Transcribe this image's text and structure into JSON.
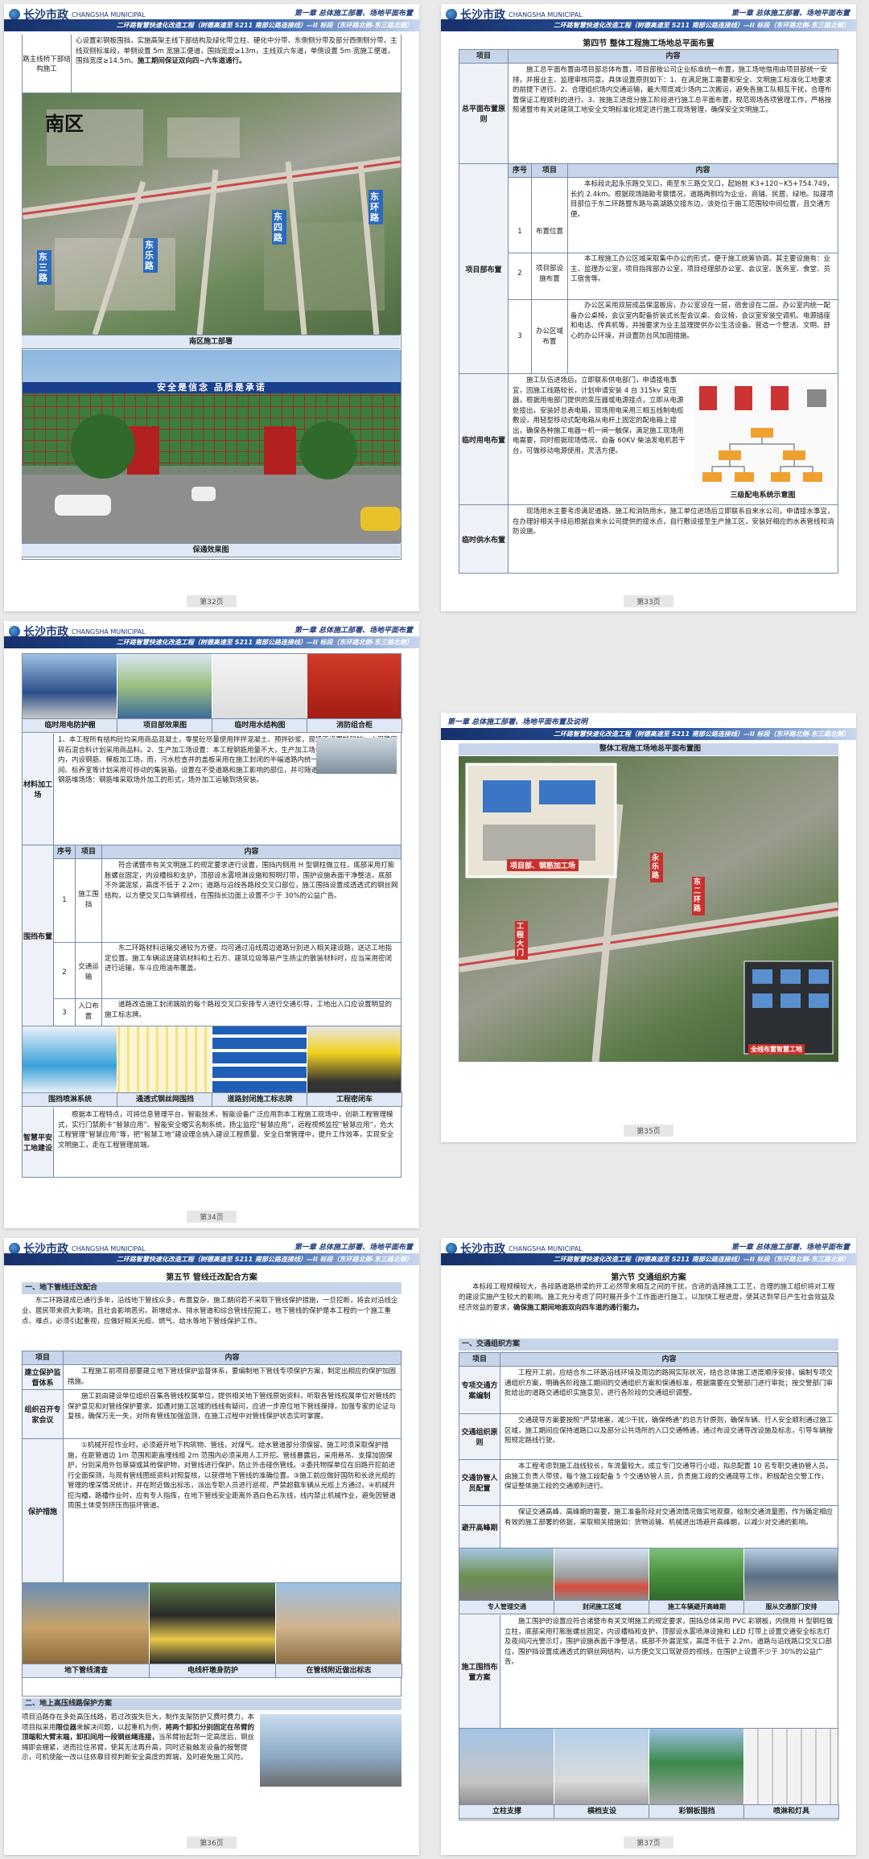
{
  "header": {
    "logo_cn": "长沙市政",
    "logo_en": "CHANGSHA MUNICIPAL",
    "chapter": "第一章 总体施工部署、场地平面布置",
    "chapter_alt": "第一章 总体施工部署、场地平面布置及说明",
    "project": "二环路智慧快速化改造工程（树德高速至 S211 南部公路连接线）—II 标段（东环路北侧-东三路北侧）"
  },
  "p32": {
    "text": "心设置彩钢板围挡，实施高架主线下部结构及绿化带立柱、硬化中分带、东侧侧分带及部分西侧侧分带，主线双侧标准段，单侧设置 5m 宽施工便道，围挡宽度≥13m，主线双六车道，单侧设置 5m 宽施工便道，围挡宽度≥14.5m。",
    "bold_text": "施工期间保证双向四~六车道通行。",
    "left_label": "路主线桥下部结构施工",
    "map_title": "南区",
    "map_labels": [
      "东三路",
      "东乐路",
      "东四路",
      "东环路"
    ],
    "cap1": "南区施工部署",
    "gate_banner": "安全是信念  品质是承诺",
    "cap2": "保通效果图",
    "page": "第32页"
  },
  "p33": {
    "section": "第四节  整体工程施工场地总平面布置",
    "th_item": "项目",
    "th_content": "内容",
    "r1_label": "总平面布置原则",
    "r1_text": "施工总平面布置由项目部总体布置，项目部按公司企业标准统一布置，施工场地借用由项目部统一安排，并报业主、监理审核同意。具体设置原则如下：1、在满足施工需要和安全、文明施工标准化工地要求的前提下进行。2、合理组织场内交通运输，最大限度减少场内二次搬运，避免各施工队相互干扰，合理布置保证工程顺利的进行。3、按施工进度分施工阶段进行施工总平面布置，规范现场各项管理工作，严格按照诸暨市有关对建筑工地安全文明标准化规定进行施工现场管理，确保安全文明施工。",
    "r2_label": "项目部布置",
    "sub_th": [
      "序号",
      "项目",
      "内容"
    ],
    "sub_rows": [
      {
        "no": "1",
        "item": "布置位置",
        "text": "本标段北起永乐路交叉口，南至东三路交叉口，起始桩 K3+120~K5+754.749，长约 2.4km。根据现场踏勘考察情况，道路两侧均为企业、商铺、民居、绿地。拟建项目部位于东二环路暨东路与高湖路交接东边，该处位于施工范围较中间位置，且交通方便。"
      },
      {
        "no": "2",
        "item": "项目部设施布置",
        "text": "本工程施工办公区域采取集中办公的形式，便于施工统筹协调。其主要设施有：业主、监理办公室，项目指挥部办公室，项目经理部办公室、会议室、医务室、食堂、员工宿舍等。"
      },
      {
        "no": "3",
        "item": "办公区域布置",
        "text": "办公区采用双层成品保温板房，办公室设在一层，宿舍设在二层。办公室内统一配备办公桌椅，会议室内配备折装式长型会议桌、会议椅，会议室安装空调机、电源插座和电话、传真机等，并按要求为业主监理提供办公生活设备。营造一个整洁、文明、舒心的办公环境，并设置防台风加固措施。"
      }
    ],
    "r3_label": "临时用电布置",
    "r3_text": "施工队伍进场后，立即联系供电部门，申请接电事宜，因施工线路较长，计划申请安装 4 台 315kv 变压器，根据用电部门提供的变压器或电源接点，立即从电源处接出，安装好总表电箱，现场用电采用三相五线制电缆敷设，用轻型移动式配电箱从电杆上固定的配电箱上接出，确保各种施工电器一机一闸一触保，满足施工现场用电需要，同时根据现场情况，自备 60KV 柴油发电机若干台，可做移动电源使用，灵活方便。",
    "r3_caption": "三级配电系统示意图",
    "r4_label": "临时供水布置",
    "r4_text": "现场用水主要考虑满足道路、施工和消防用水，施工单位进场后立即联系自来水公司，申请接水事宜，在办理好相关手续后根据自来水公司提供的接水点，自行敷设接至生产施工区，安装好相应的水表管线和消防设施。",
    "page": "第33页"
  },
  "p34": {
    "caps": [
      "临时用电防护棚",
      "项目部效果图",
      "临时用水结构图",
      "消防组合柜"
    ],
    "r1_label": "材料加工场",
    "r1_text": "1、本工程所有结构砼均采用商品混凝土，零星砼尽量使用拌拌混凝土、预拌砂浆，现场不设置拌和站；水泥稳定碎石混合料计划采用商品料。2、生产加工场设置：本工程钢筋用量不大，生产加工场设置在封闭的半幅施工道路内，内设钢筋、模板加工场，而，污水检查井的盖板采用在施工封闭的半幅道路内统一预制，工具仓库、电工间、标养室等计划采用可移动的集装箱，设置在不受道路和施工影响的部位，并可随道路分幅进行移动安置。3、钢筋堆场场：钢筋堆采取场外加工的形式，场外加工运输到场安装。",
    "sub_th": [
      "序号",
      "项目",
      "内容"
    ],
    "r2_label": "围挡布置",
    "r2_rows": [
      {
        "no": "1",
        "item": "施工围挡",
        "text": "符合诸暨市有关文明施工的规定要求进行设置，围挡内侧用 H 型钢柱做立柱，底部采用打膨胀螺丝固定，内设槽档和支护，顶部设水雾喷淋设施和照明灯带，围护设施表面干净整洁，底部不外漏泥浆，高度不低于 2.2m；道路与沿线各路段交叉口部位，施工围挡设置成透透式的钢丝网结构，以方便交叉口车辆视线，在围挡长边面上设置不少于 30%的公益广告。"
      },
      {
        "no": "2",
        "item": "交通运输",
        "text": "东二环路材料运输交通较为方便，均可通过沿线周边道路分别进入相关建设路，送达工地指定位置。施工车辆运送建筑材料和土石方、建筑垃圾等易产生扬尘的散装材料时，应当采用密闭进行运输，车斗应用油布覆盖。"
      },
      {
        "no": "3",
        "item": "入口布置",
        "text": "道路改造施工封闭端前的每个路段交叉口安排专人进行交通引导，工地出入口应设置明显的施工标志牌。"
      }
    ],
    "caps2": [
      "围挡喷淋系统",
      "通透式钢丝网围挡",
      "道路封闭施工标志牌",
      "工程密闭车"
    ],
    "r3_label": "智慧平安工地建设",
    "r3_text": "根据本工程特点，可将信息管理平台、智能技术、智能设备广泛应用到本工程施工现场中，创新工程管理模式，实行门禁刷卡“智慧应用”、智能安全帽实名制系统，扬尘监控“智慧应用”，远程视频监控“智慧应用”，危大工程管理“智慧应用”等，把“智慧工地”建设理念纳入建设工程质量、安全日常管理中，提升工作效率，实现安全文明施工，走在工程管理前端。",
    "page": "第34页"
  },
  "p35": {
    "title": "整体工程施工场地总平面布置图",
    "labels": [
      "项目部、钢筋加工场",
      "工程大门",
      "永乐路",
      "东二环路"
    ],
    "bottom_label": "全线布置智慧工地",
    "page": "第35页"
  },
  "p36": {
    "section": "第五节  管线迁改配合方案",
    "h1": "一、地下管线迁改配合",
    "intro": "东二环路建成已通行多年，沿线地下管线众多，布置复杂，施工期间若不采取下管线保护措施，一旦挖断，将会对沿线企业、居民带来很大影响，且社会影响恶劣。新增给水、排水管道和综合管线挖掘工，地下管线的保护是本工程的一个施工重点、难点，必须引起重视，应做好相关光缆、燃气、给水等地下管线保护工作。",
    "th_item": "项目",
    "th_content": "内容",
    "rows": [
      {
        "label": "建立保护监督体系",
        "text": "工程施工前项目部要建立地下管线保护监督体系，要编制地下管线专项保护方案，制定出相应的保护加固措施。"
      },
      {
        "label": "组织召开专家会议",
        "text": "施工前由建设单位组织召集各管线权属单位，提供相关地下管线原始资料，听取各管线权属单位对管线的保护意见和对管线保护要求。如遇对施工区域的线线有疑问，应进一步原位地下管线摸排，加强专家的论证与复核，确保万无一失，对所有管线加强监测，在施工过程中对管线保护状态实时掌握。"
      },
      {
        "label": "保护措施",
        "text": "①机械开挖作业时，必须避开地下构筑物、管线，对煤气、给水管道部分须保留。施工时须采取保护措施，在距管道边 1m 范围和距直埋线缆 2m 范围内必须采用人工开挖。管线暴露后，采用悬吊、支撑加固保护，分别采用外包草袋或其他保护物，对管线进行保护，防止外击碰伤管线。②委托物探单位在旧路开挖前进行全面探测，与现有管线图纸资料对照复核，以获得地下管线的准确位置。③施工前应做好国防和长途光缆的管理的埋深情况统计，并在附近做出标志，派出专职人员进行巡视，严禁超载车辆从光缆上方通过。④机械开挖沟槽，路槽作业时，应有专人指挥，在地下管线安全距离外酒白色石灰线，线内禁止机械作业，避免因管道周围土体受到挤压而损坏管道。"
      }
    ],
    "caps": [
      "地下管线清查",
      "电线杆墩身防护",
      "在管线附近做出标志"
    ],
    "h2": "二、地上高压线路保护方案",
    "h2_text_a": "项目沿路存在多处高压线路，若过改拔失巨大，制作支架防护又费时费力，本项目拟采用",
    "h2_text_b": "限位器",
    "h2_text_c": "来解决问题，以起重机为例，",
    "h2_text_d": "将两个卸扣分别固定在吊臂的顶端和大臂末端，卸扣间用一段钢丝绳连接，",
    "h2_text_e": "当吊臂抬起到一定高度后，钢丝绳即会绷紧，进而拉住吊臂，使其无法再升高，同时还能触发设备的报警提示，可机使能一改以往依靠目视判断安全高度的弊端，及时避免施工风险。",
    "page": "第36页"
  },
  "p37": {
    "section": "第六节  交通组织方案",
    "intro_a": "本标段工程规模较大，各段路道路桥梁的开工必然带来相互之间的干扰，合适的选择施工工艺，合理的施工组织将对工程的建设实施产生较大的影响。施工充分考虑了同时展开多个工作面进行施工，以加快工程进度，使其达到早日产生社会效益及经济效益的要求，",
    "intro_b": "确保施工期间地面双向四车道的通行能力。",
    "h1": "一、交通组织方案",
    "th_item": "项目",
    "th_content": "内容",
    "rows": [
      {
        "label": "专项交通方案编制",
        "text": "工程开工前，应结合东二环路沿线环境及周边的路网实际状况，结合总体施工进度顺序安排，编制专项交通组织方案，明确各阶段施工期间的交通组织方案和保通标准，根据需要在交警部门进行审批；按交警部门审批给出的道路交通组织实施意见，进行各阶段的交通组织调整。"
      },
      {
        "label": "交通组织原则",
        "text": "交通疏导方案要按照“严禁堵塞，减少干扰，确保畅通”的总方针原则，确保车辆、行人安全顺利通过施工区域，施工期间应保持道路口以及部分公共场所的入口交通畅通，通过布设交通导改设施及标志，引导车辆按照规定路线行驶。"
      },
      {
        "label": "交通协管人员配置",
        "text": "本工程考虑到施工战线较长，车流量较大，成立专门交通导行小组，拟总配置 10 名专职交通协管人员，由施工负责人带领，每个施工段配备 5 个交通协管人员，负责施工段的交通疏导工作，积极配合交警工作，保证整体施工段的交通顺利进行。"
      },
      {
        "label": "避开高峰期",
        "text": "保证交通高峰、高峰期的需要，施工准备阶段对交通流情况做实地观察，绘制交通流量图，作为确定相应有效的施工部署的依据，采取相关措施如：货物运输、机械进出场避开高峰期，以减少对交通的影响。"
      }
    ],
    "caps": [
      "专人管理交通",
      "封闭施工区域",
      "施工车辆避开高峰期",
      "服从交通部门安排"
    ],
    "r5_label": "施工围挡布置方案",
    "r5_text": "施工围护的设置应符合诸暨市有关文明施工的规定要求，围挡总体采用 PVC 彩钢板，内侧用 H 型钢柱做立柱，底部采用打膨胀螺丝固定，内设槽档和支护，顶部设水雾喷淋设施和 LED 灯带上设置交通安全标志灯及夜间闪光警示灯，围护设施表面干净整洁，底部不外漏泥浆，高度不低于 2.2m，道路与沿线路口交叉口部位，围护挡设置成通透式的钢丝网结构，以方便交叉口驾驶员的视线，在围护上设置不少于 30%的公益广告。",
    "caps2": [
      "立柱支撑",
      "横档支设",
      "彩钢板围挡",
      "喷淋和灯具"
    ],
    "page": "第37页"
  }
}
